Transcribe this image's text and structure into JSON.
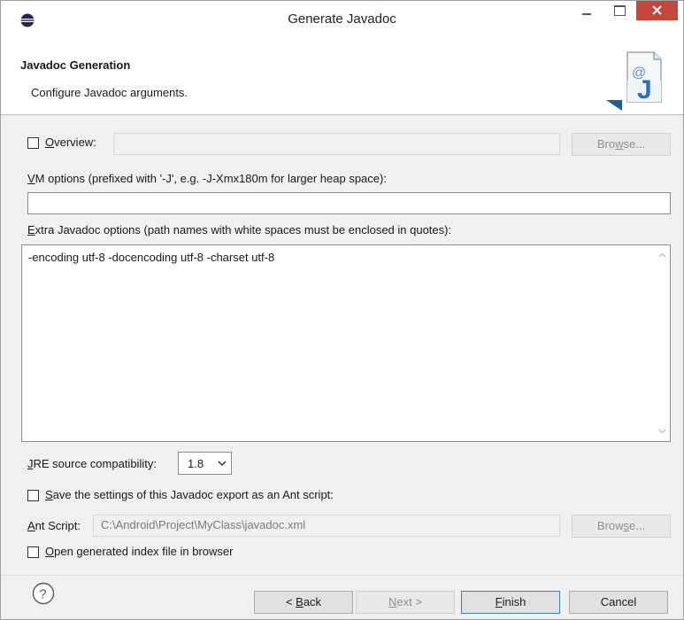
{
  "window": {
    "title": "Generate Javadoc"
  },
  "banner": {
    "title": "Javadoc Generation",
    "subtitle": "Configure Javadoc arguments."
  },
  "overview": {
    "label_pre": "",
    "label_mnemonic": "O",
    "label_post": "verview:",
    "checked": false,
    "value": "",
    "browse_label_pre": "Bro",
    "browse_label_mnemonic": "w",
    "browse_label_post": "se..."
  },
  "vm_options": {
    "label_mnemonic": "V",
    "label_post": "M options (prefixed with '-J', e.g. -J-Xmx180m for larger heap space):",
    "value": ""
  },
  "extra_options": {
    "label_mnemonic": "E",
    "label_post": "xtra Javadoc options (path names with white spaces must be enclosed in quotes):",
    "value": "-encoding utf-8 -docencoding utf-8 -charset utf-8"
  },
  "jre": {
    "label_mnemonic": "J",
    "label_post": "RE source compatibility:",
    "selected": "1.8"
  },
  "ant_save": {
    "label_mnemonic": "S",
    "label_post": "ave the settings of this Javadoc export as an Ant script:",
    "checked": false
  },
  "ant_script": {
    "label_mnemonic": "A",
    "label_post": "nt Script:",
    "value": "C:\\Android\\Project\\MyClass\\javadoc.xml",
    "browse_label_pre": "Brow",
    "browse_label_mnemonic": "s",
    "browse_label_post": "e..."
  },
  "open_index": {
    "label_mnemonic": "O",
    "label_post": "pen generated index file in browser",
    "checked": false
  },
  "footer": {
    "back_pre": "< ",
    "back_mnemonic": "B",
    "back_post": "ack",
    "next_mnemonic": "N",
    "next_post": "ext >",
    "finish_mnemonic": "F",
    "finish_post": "inish",
    "cancel_label": "Cancel"
  },
  "colors": {
    "close_button": "#c7463c",
    "focus_border": "#5b9bd5",
    "default_button_border": "#3c7fb1"
  }
}
